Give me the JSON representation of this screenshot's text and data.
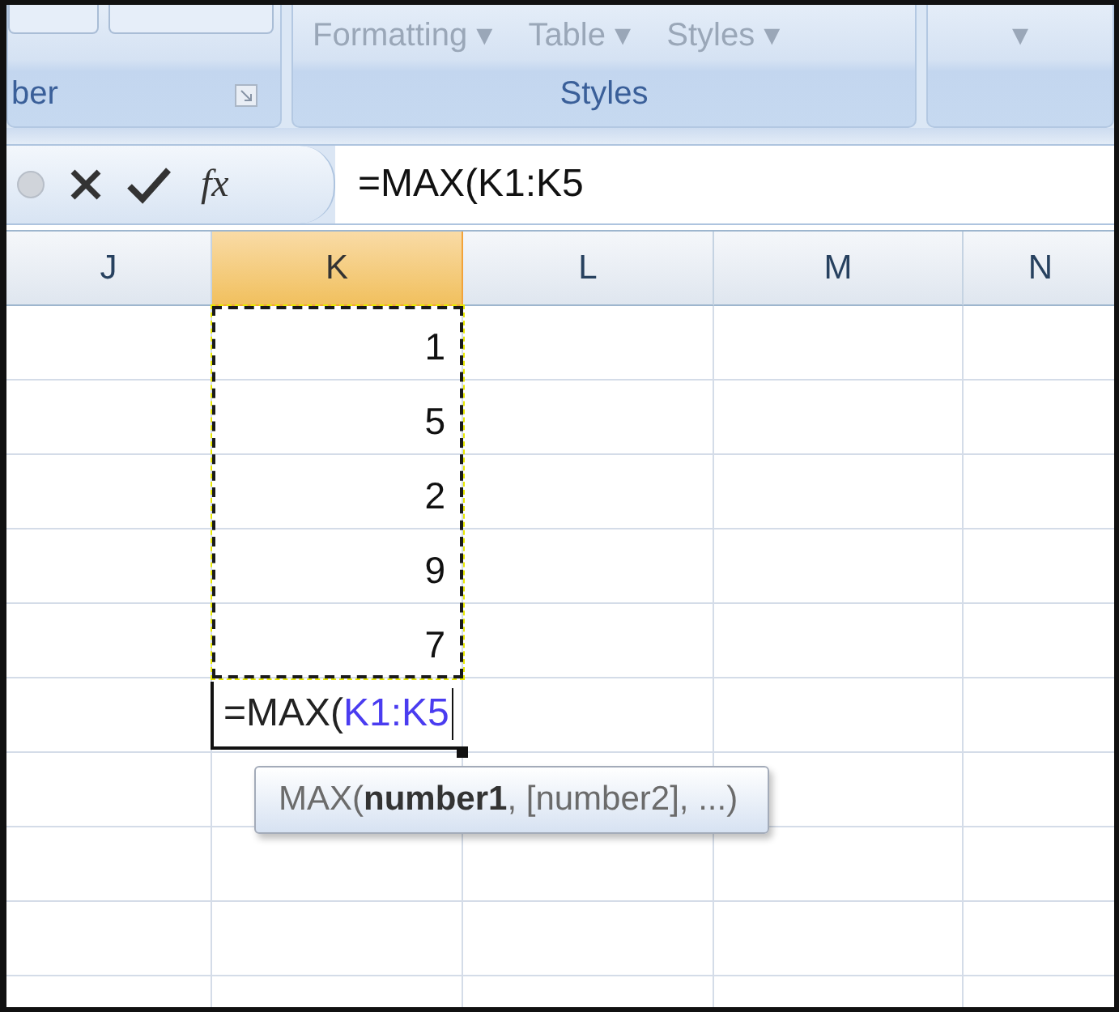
{
  "ribbon": {
    "groups": [
      {
        "label": "ber",
        "launcher": true
      },
      {
        "label": "Styles",
        "buttons": [
          {
            "label": "Formatting ▾"
          },
          {
            "label": "Table ▾"
          },
          {
            "label": "Styles ▾"
          }
        ],
        "launcher": false
      },
      {
        "buttons": [
          {
            "label": "▾"
          }
        ],
        "launcher": false
      }
    ]
  },
  "formula_bar": {
    "fx": "fx",
    "value": "=MAX(K1:K5"
  },
  "columns": [
    {
      "label": "J",
      "selected": false
    },
    {
      "label": "K",
      "selected": true
    },
    {
      "label": "L",
      "selected": false
    },
    {
      "label": "M",
      "selected": false
    },
    {
      "label": "N",
      "selected": false
    }
  ],
  "column_k_values": [
    "1",
    "5",
    "2",
    "9",
    "7"
  ],
  "editing_cell": {
    "prefix": "=MAX(",
    "reference": "K1:K5"
  },
  "tooltip": "MAX(**number1**, [number2], ...)"
}
